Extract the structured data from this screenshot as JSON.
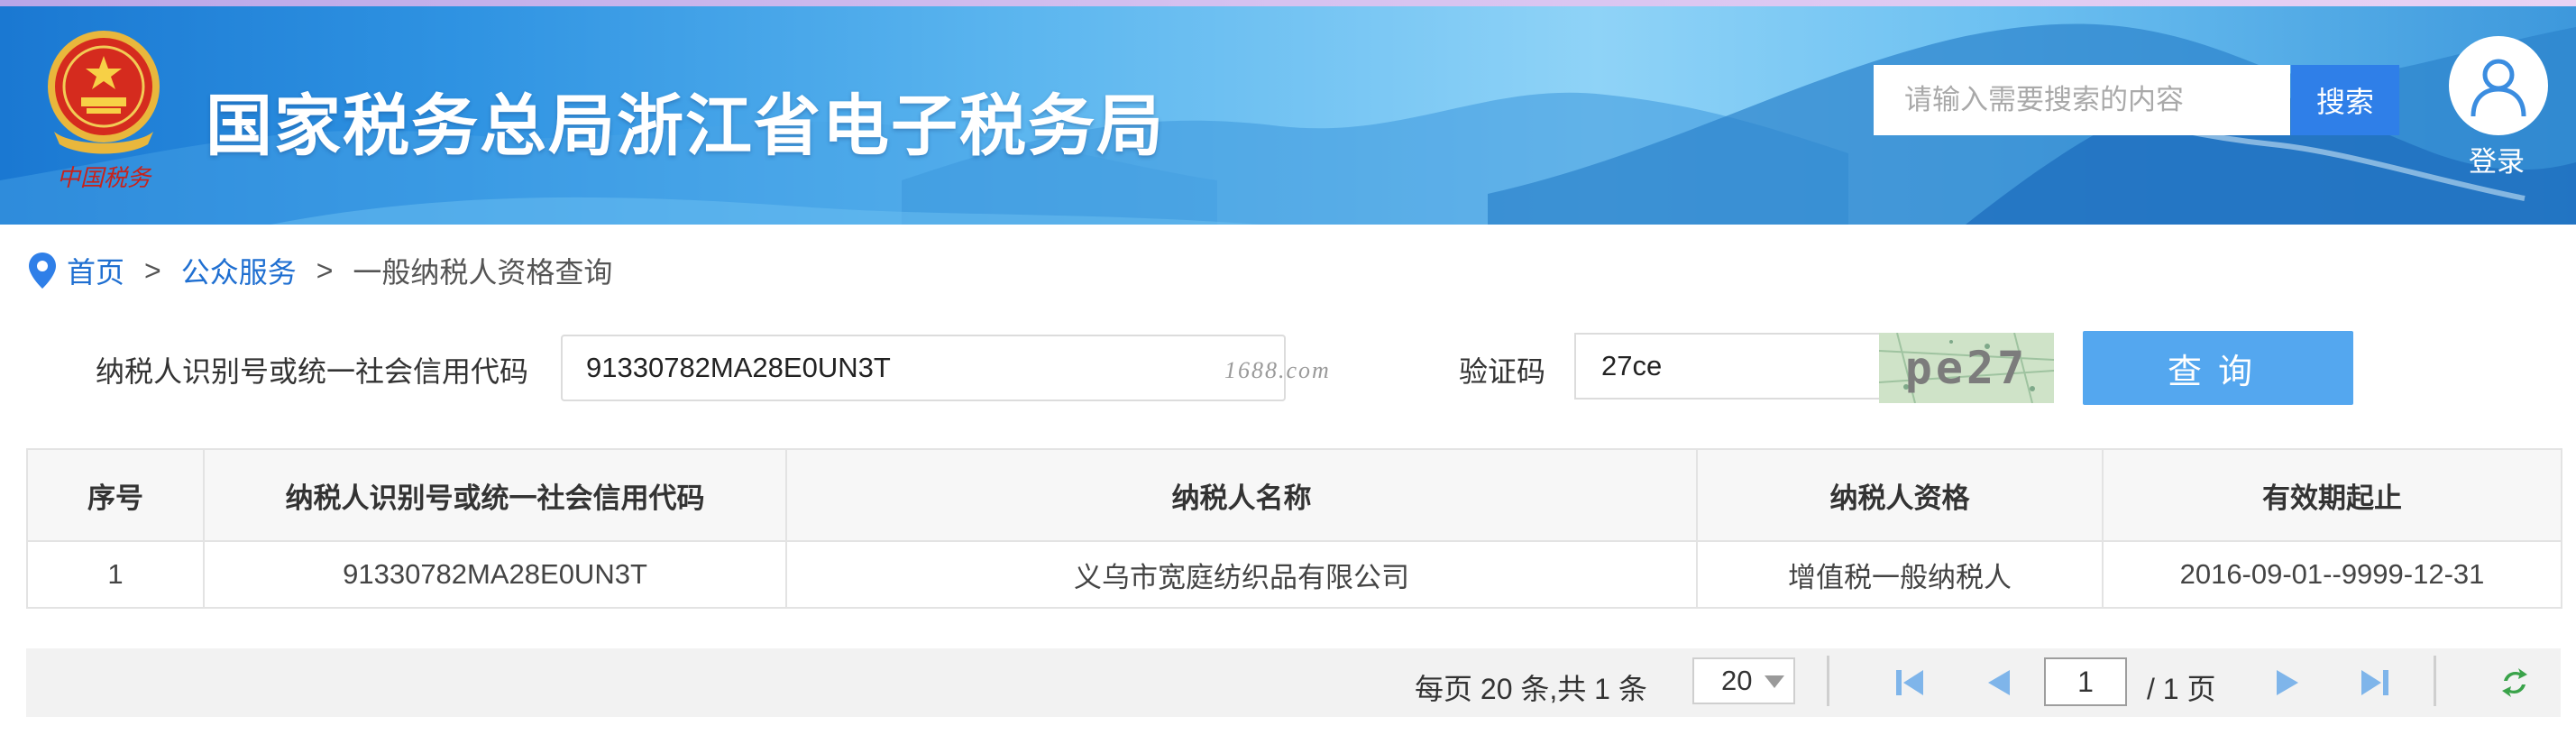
{
  "header": {
    "site_title": "国家税务总局浙江省电子税务局",
    "emblem_caption": "中国税务",
    "search_placeholder": "请输入需要搜索的内容",
    "search_button": "搜索",
    "login_label": "登录"
  },
  "breadcrumb": {
    "items": [
      "首页",
      "公众服务",
      "一般纳税人资格查询"
    ],
    "separator": ">"
  },
  "query": {
    "taxpayer_id_label": "纳税人识别号或统一社会信用代码",
    "taxpayer_id_value": "91330782MA28E0UN3T",
    "watermark": "1688.com",
    "captcha_label": "验证码",
    "captcha_value": "27ce",
    "captcha_image_text": "pe27",
    "query_button": "查询"
  },
  "table": {
    "headers": [
      "序号",
      "纳税人识别号或统一社会信用代码",
      "纳税人名称",
      "纳税人资格",
      "有效期起止"
    ],
    "rows": [
      [
        "1",
        "91330782MA28E0UN3T",
        "义乌市宽庭纺织品有限公司",
        "增值税一般纳税人",
        "2016-09-01--9999-12-31"
      ]
    ]
  },
  "pager": {
    "summary": "每页 20 条,共 1 条",
    "page_size": "20",
    "current_page": "1",
    "total_pages": "/ 1 页"
  },
  "colors": {
    "accent": "#2f7fe8",
    "query_button": "#54a7ef",
    "link": "#1f6fd1",
    "pager_icons": "#5da3e8",
    "refresh_icon": "#3aa34a"
  },
  "icons": {
    "emblem": "national-emblem-icon",
    "avatar": "user-icon",
    "breadcrumb": "location-pin-icon",
    "first": "first-page-icon",
    "prev": "prev-page-icon",
    "next": "next-page-icon",
    "last": "last-page-icon",
    "refresh": "refresh-icon"
  }
}
